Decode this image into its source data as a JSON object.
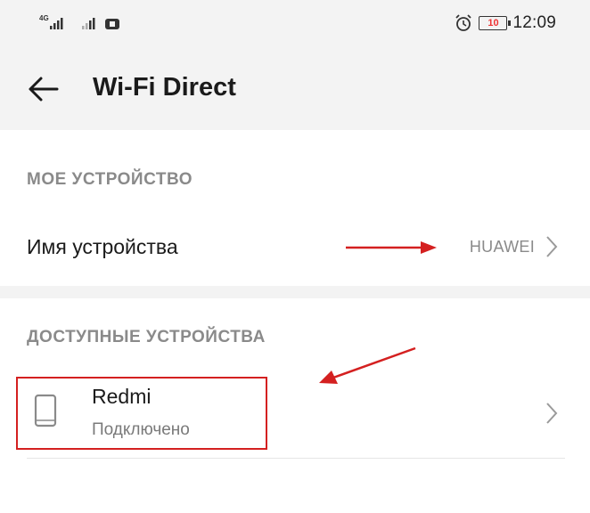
{
  "status_bar": {
    "signal1_label": "4G",
    "time": "12:09",
    "battery": "10"
  },
  "app_bar": {
    "title": "Wi-Fi Direct",
    "back_icon": "arrow-left-icon"
  },
  "my_device": {
    "header": "МОЕ УСТРОЙСТВО",
    "name_label": "Имя устройства",
    "name_value": "HUAWEI"
  },
  "available": {
    "header": "ДОСТУПНЫЕ УСТРОЙСТВА",
    "devices": [
      {
        "name": "Redmi",
        "status": "Подключено",
        "icon": "phone-icon"
      }
    ]
  },
  "colors": {
    "annotation": "#d42020",
    "app_bar_bg": "#f3f3f3",
    "secondary_text": "#8a8a8a"
  }
}
